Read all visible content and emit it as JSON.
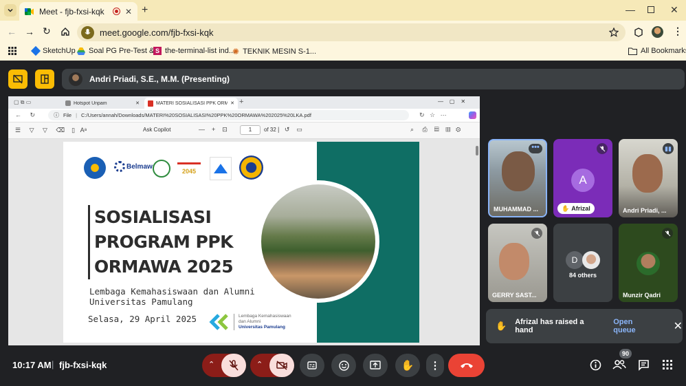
{
  "browser": {
    "tab_title": "Meet - fjb-fxsi-kqk",
    "url": "meet.google.com/fjb-fxsi-kqk",
    "bookmarks": [
      "SketchUp",
      "Soal PG Pre-Test &...",
      "the-terminal-list ind...",
      "TEKNIK MESIN S-1..."
    ],
    "all_bookmarks": "All Bookmarks"
  },
  "meet": {
    "presenter": "Andri Priadi, S.E., M.M. (Presenting)",
    "time": "10:17 AM",
    "code": "fjb-fxsi-kqk",
    "people_count": "90",
    "notice_text": "Afrizal has raised a hand",
    "notice_action": "Open queue"
  },
  "shared": {
    "tab1": "Hotspot Unpam",
    "tab2": "MATERI SOSIALISASI PPK ORMAWA",
    "file_label": "File",
    "path": "C:/Users/annah/Downloads/MATERI%20SOSIALISASI%20PPK%20ORMAWA%202025%20LKA.pdf",
    "ask_copilot": "Ask Copilot",
    "page_num": "1",
    "page_total": "of 32",
    "slide": {
      "title1": "SOSIALISASI",
      "title2": "PROGRAM PPK",
      "title3": "ORMAWA 2025",
      "sub1": "Lembaga Kemahasiswaan dan Alumni",
      "sub2": "Universitas Pamulang",
      "date": "Selasa, 29 April 2025",
      "footer1": "Lembaga Kemahasiswaan",
      "footer2": "dan Alumni",
      "footer3": "Universitas Pamulang",
      "belmawa": "Belmawa",
      "year": "2045"
    }
  },
  "participants": [
    {
      "name": "MUHAMMAD ..."
    },
    {
      "name": "Afrizal",
      "initial": "A"
    },
    {
      "name": "Andri Priadi, ..."
    },
    {
      "name": "GERRY SAST..."
    },
    {
      "name": "84 others",
      "initial": "D"
    },
    {
      "name": "Munzir Qadri"
    }
  ],
  "colors": {
    "accent": "#fbbc04",
    "end_call": "#ea4335",
    "muted": "#f28b82",
    "link": "#8ab4f8",
    "teal": "#0f6e64"
  }
}
